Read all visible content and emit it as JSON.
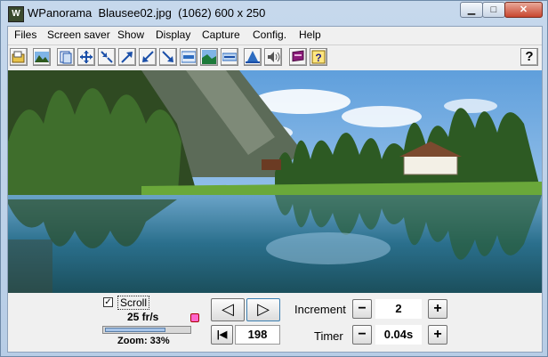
{
  "window": {
    "title": "WPanorama  Blausee02.jpg  (1062) 600 x 250",
    "app_icon_glyph": "W",
    "minimize_glyph": "▁",
    "maximize_glyph": "□",
    "close_glyph": "✕"
  },
  "menu": {
    "items": [
      "Files",
      "Screen saver",
      "Show",
      "Display",
      "Capture",
      "Config.",
      "Help"
    ]
  },
  "toolbar": {
    "buttons": [
      {
        "name": "open-file-icon",
        "color": "#2d6cc0"
      },
      {
        "name": "landscape-image-icon",
        "color": "#2e5a1e"
      },
      {
        "name": "copy-frame-icon",
        "color": "#1b4fa8"
      },
      {
        "name": "fit-expand-icon",
        "color": "#1b4fa8"
      },
      {
        "name": "shrink-arrows-icon",
        "color": "#1b4fa8"
      },
      {
        "name": "arrow-up-right-icon",
        "color": "#1b4fa8"
      },
      {
        "name": "arrow-down-left-icon",
        "color": "#1b4fa8"
      },
      {
        "name": "arrow-down-right-icon",
        "color": "#1b4fa8"
      },
      {
        "name": "panorama-strip-icon",
        "color": "#2d6cc0"
      },
      {
        "name": "landscape-view-icon",
        "color": "#1c7a3a"
      },
      {
        "name": "horizon-bar-icon",
        "color": "#2d6cc0"
      },
      {
        "name": "tree-blue-icon",
        "color": "#1b4fa8"
      },
      {
        "name": "speaker-icon",
        "color": "#555555"
      },
      {
        "name": "book-icon",
        "color": "#8b1a7a"
      },
      {
        "name": "help-book-icon",
        "color": "#d4a200"
      }
    ],
    "help_label": "?"
  },
  "panorama": {
    "description_icon": "panorama-photo",
    "sky_color": "#7fb4e6",
    "water_color": "#2a6f8c"
  },
  "controls": {
    "scroll_checked": true,
    "scroll_check_glyph": "✓",
    "scroll_label": "Scroll",
    "fps": "25 fr/s",
    "zoom": "Zoom: 33%",
    "zoom_level": 0.72,
    "prev_glyph": "◁",
    "next_glyph": "▷",
    "first_glyph": "|◀",
    "frame_value": "198",
    "increment_label": "Increment",
    "increment_value": "2",
    "timer_label": "Timer",
    "timer_value": "0.04s",
    "minus_glyph": "−",
    "plus_glyph": "+"
  }
}
